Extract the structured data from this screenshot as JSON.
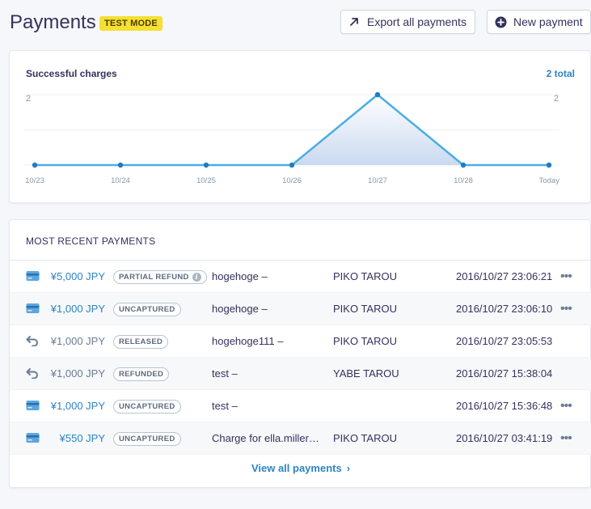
{
  "header": {
    "title": "Payments",
    "badge": "TEST MODE",
    "export_label": "Export all payments",
    "new_label": "New payment"
  },
  "chart": {
    "title": "Successful charges",
    "total": "2 total",
    "y_max_left": "2",
    "y_max_right": "2"
  },
  "chart_data": {
    "type": "area",
    "title": "Successful charges",
    "categories": [
      "10/23",
      "10/24",
      "10/25",
      "10/26",
      "10/27",
      "10/28",
      "Today"
    ],
    "values": [
      0,
      0,
      0,
      0,
      2,
      0,
      0
    ],
    "ylim": [
      0,
      2
    ],
    "grid": true,
    "colors": {
      "line": "#4aaee3",
      "fill": "#c9daf0"
    }
  },
  "payments": {
    "heading": "MOST RECENT PAYMENTS",
    "rows": [
      {
        "icon": "credit-card-icon",
        "amount": "¥5,000 JPY",
        "status": "PARTIAL REFUND",
        "desc": "hogehoge –",
        "customer": "PIKO TAROU",
        "date": "2016/10/27 23:06:21",
        "more": "•••"
      },
      {
        "icon": "credit-card-icon",
        "amount": "¥1,000 JPY",
        "status": "UNCAPTURED",
        "desc": "hogehoge –",
        "customer": "PIKO TAROU",
        "date": "2016/10/27 23:06:10",
        "more": "•••"
      },
      {
        "icon": "refund-arrow-icon",
        "amount": "¥1,000 JPY",
        "status": "RELEASED",
        "desc": "hogehoge111 –",
        "customer": "PIKO TAROU",
        "date": "2016/10/27 23:05:53",
        "more": ""
      },
      {
        "icon": "refund-arrow-icon",
        "amount": "¥1,000 JPY",
        "status": "REFUNDED",
        "desc": "test –",
        "customer": "YABE TAROU",
        "date": "2016/10/27 15:38:04",
        "more": ""
      },
      {
        "icon": "credit-card-icon",
        "amount": "¥1,000 JPY",
        "status": "UNCAPTURED",
        "desc": "test –",
        "customer": "",
        "date": "2016/10/27 15:36:48",
        "more": "•••"
      },
      {
        "icon": "credit-card-icon",
        "amount": "¥550 JPY",
        "status": "UNCAPTURED",
        "desc": "Charge for ella.miller…",
        "customer": "PIKO TAROU",
        "date": "2016/10/27 03:41:19",
        "more": "•••"
      }
    ],
    "view_all": "View all payments",
    "view_all_chevron": "›"
  },
  "colors": {
    "accent": "#2c84c6",
    "badge": "#f5e033",
    "chart_line": "#4aaee3"
  }
}
